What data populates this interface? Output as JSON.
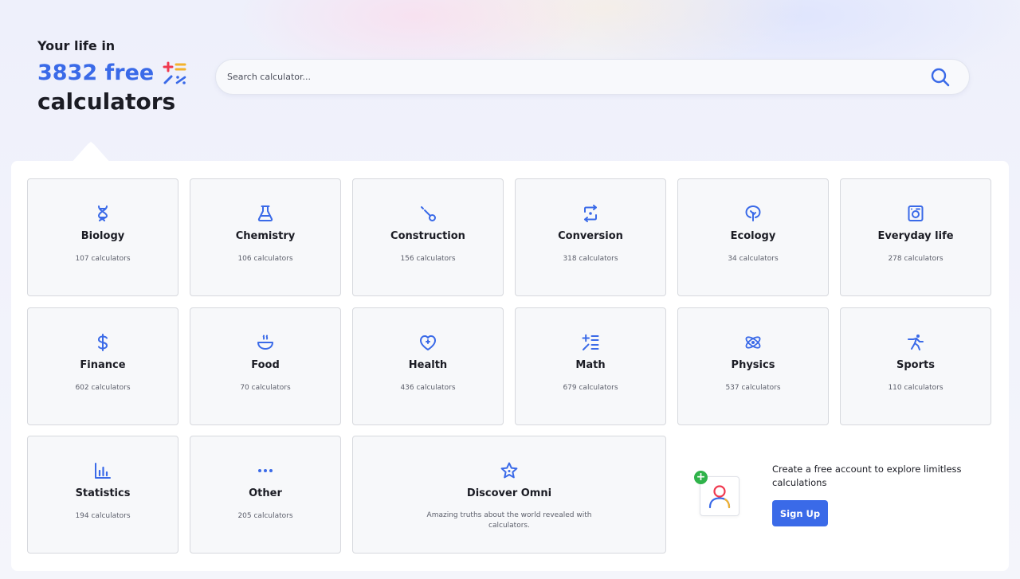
{
  "hero": {
    "line1": "Your life in",
    "line2": "3832 free",
    "line3": "calculators"
  },
  "search": {
    "placeholder": "Search calculator..."
  },
  "categories": [
    {
      "name": "Biology",
      "count": "107 calculators",
      "icon": "dna-icon"
    },
    {
      "name": "Chemistry",
      "count": "106 calculators",
      "icon": "flask-icon"
    },
    {
      "name": "Construction",
      "count": "156 calculators",
      "icon": "wrench-icon"
    },
    {
      "name": "Conversion",
      "count": "318 calculators",
      "icon": "conversion-icon"
    },
    {
      "name": "Ecology",
      "count": "34 calculators",
      "icon": "leaf-icon"
    },
    {
      "name": "Everyday life",
      "count": "278 calculators",
      "icon": "washing-machine-icon"
    },
    {
      "name": "Finance",
      "count": "602 calculators",
      "icon": "dollar-icon"
    },
    {
      "name": "Food",
      "count": "70 calculators",
      "icon": "bowl-icon"
    },
    {
      "name": "Health",
      "count": "436 calculators",
      "icon": "heart-icon"
    },
    {
      "name": "Math",
      "count": "679 calculators",
      "icon": "math-operators-icon"
    },
    {
      "name": "Physics",
      "count": "537 calculators",
      "icon": "atom-icon"
    },
    {
      "name": "Sports",
      "count": "110 calculators",
      "icon": "running-person-icon"
    },
    {
      "name": "Statistics",
      "count": "194 calculators",
      "icon": "bar-chart-icon"
    },
    {
      "name": "Other",
      "count": "205 calculators",
      "icon": "more-dots-icon"
    }
  ],
  "discover": {
    "title": "Discover Omni",
    "description": "Amazing truths about the world revealed with calculators.",
    "icon": "star-icon"
  },
  "signup": {
    "text": "Create a free account to explore limitless calculations",
    "button": "Sign Up",
    "badge": "+"
  },
  "colors": {
    "accent": "#3a6ae8",
    "text": "#1b1c24",
    "muted": "#5c5f6b",
    "card_bg": "#f7f8fa",
    "card_border": "#d7d9de",
    "badge_green": "#2fb34a"
  }
}
